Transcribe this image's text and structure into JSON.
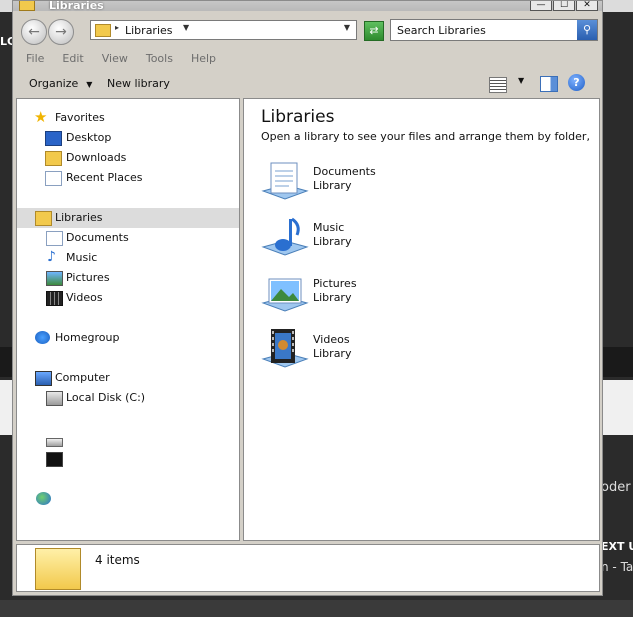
{
  "window": {
    "title": "Libraries",
    "controls": [
      "—",
      "☐",
      "✕"
    ]
  },
  "background": {
    "text_left": "LC",
    "text_right_1": "oder",
    "text_right_2": "EXT U",
    "text_right_3": "n - Ta"
  },
  "address_bar": {
    "path": "Libraries",
    "separator": "▸"
  },
  "search": {
    "placeholder": "Search Libraries"
  },
  "menu": [
    "File",
    "Edit",
    "View",
    "Tools",
    "Help"
  ],
  "toolbar": {
    "organize_label": "Organize",
    "new_library_label": "New library"
  },
  "nav_pane": {
    "favorites": {
      "label": "Favorites",
      "items": [
        "Desktop",
        "Downloads",
        "Recent Places"
      ]
    },
    "libraries": {
      "label": "Libraries",
      "items": [
        "Documents",
        "Music",
        "Pictures",
        "Videos"
      ]
    },
    "homegroup": {
      "label": "Homegroup"
    },
    "computer": {
      "label": "Computer",
      "items": [
        "Local Disk (C:)"
      ]
    }
  },
  "content": {
    "title": "Libraries",
    "subtitle": "Open a library to see your files and arrange them by folder, d...",
    "libraries": [
      {
        "name": "Documents",
        "kind": "Library",
        "icon": "documents-library-icon"
      },
      {
        "name": "Music",
        "kind": "Library",
        "icon": "music-library-icon"
      },
      {
        "name": "Pictures",
        "kind": "Library",
        "icon": "pictures-library-icon"
      },
      {
        "name": "Videos",
        "kind": "Library",
        "icon": "videos-library-icon"
      }
    ]
  },
  "status": {
    "item_count": "4 items"
  },
  "colors": {
    "window_chrome": "#d4d0c8",
    "selection": "#dcdcdc",
    "folder_yellow": "#f2c94c",
    "accent_blue": "#2a64c8"
  }
}
